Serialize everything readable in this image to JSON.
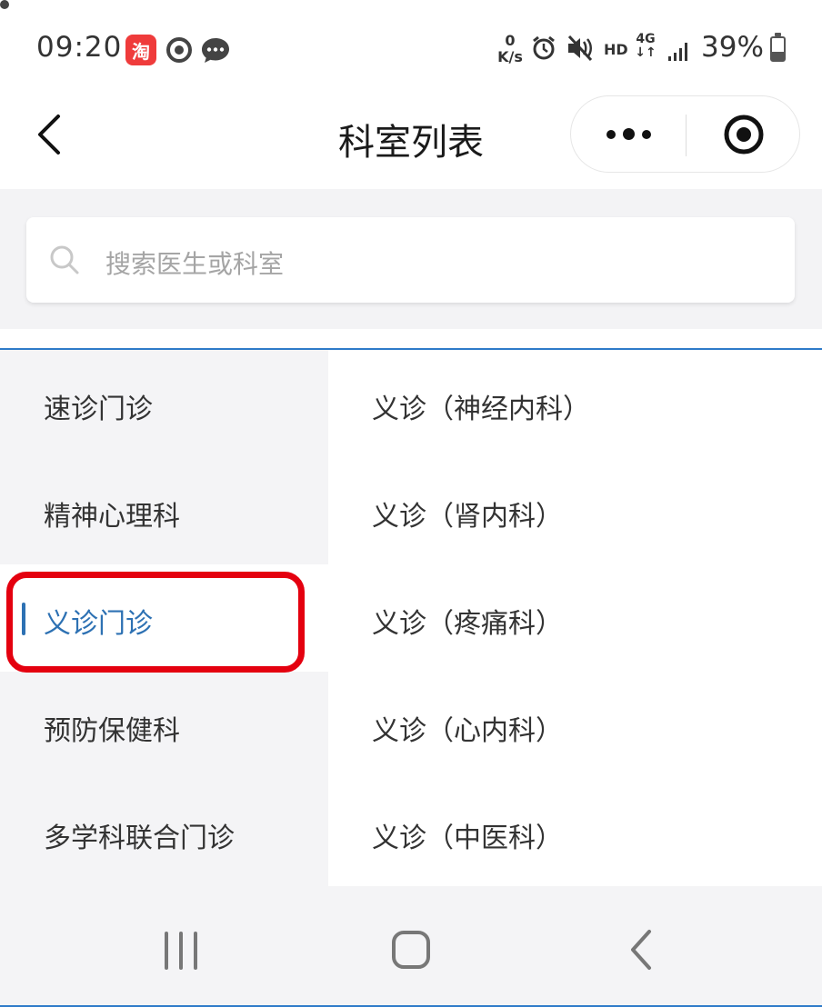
{
  "status_bar": {
    "time": "09:20",
    "taobao_icon_text": "淘",
    "net_speed_value": "0",
    "net_speed_unit": "K/s",
    "hd_label": "HD",
    "network_label": "4G",
    "battery_percent": "39%",
    "battery_level": 0.39
  },
  "nav": {
    "title": "科室列表"
  },
  "search": {
    "placeholder": "搜索医生或科室"
  },
  "departments": {
    "items": [
      {
        "label": "速诊门诊"
      },
      {
        "label": "精神心理科"
      },
      {
        "label": "义诊门诊"
      },
      {
        "label": "预防保健科"
      },
      {
        "label": "多学科联合门诊"
      }
    ],
    "active_index": 2
  },
  "sub_departments": {
    "items": [
      {
        "label": "义诊（神经内科）"
      },
      {
        "label": "义诊（肾内科）"
      },
      {
        "label": "义诊（疼痛科）"
      },
      {
        "label": "义诊（心内科）"
      },
      {
        "label": "义诊（中医科）"
      }
    ]
  },
  "colors": {
    "accent": "#2d71b3",
    "highlight_border": "#e4000f",
    "list_bg": "#f4f4f6"
  },
  "icons": {
    "back": "chevron-left-icon",
    "more": "more-dots-icon",
    "close": "target-close-icon",
    "search": "search-icon",
    "recent_apps": "recent-apps-icon",
    "home": "home-icon",
    "system_back": "system-back-icon"
  }
}
